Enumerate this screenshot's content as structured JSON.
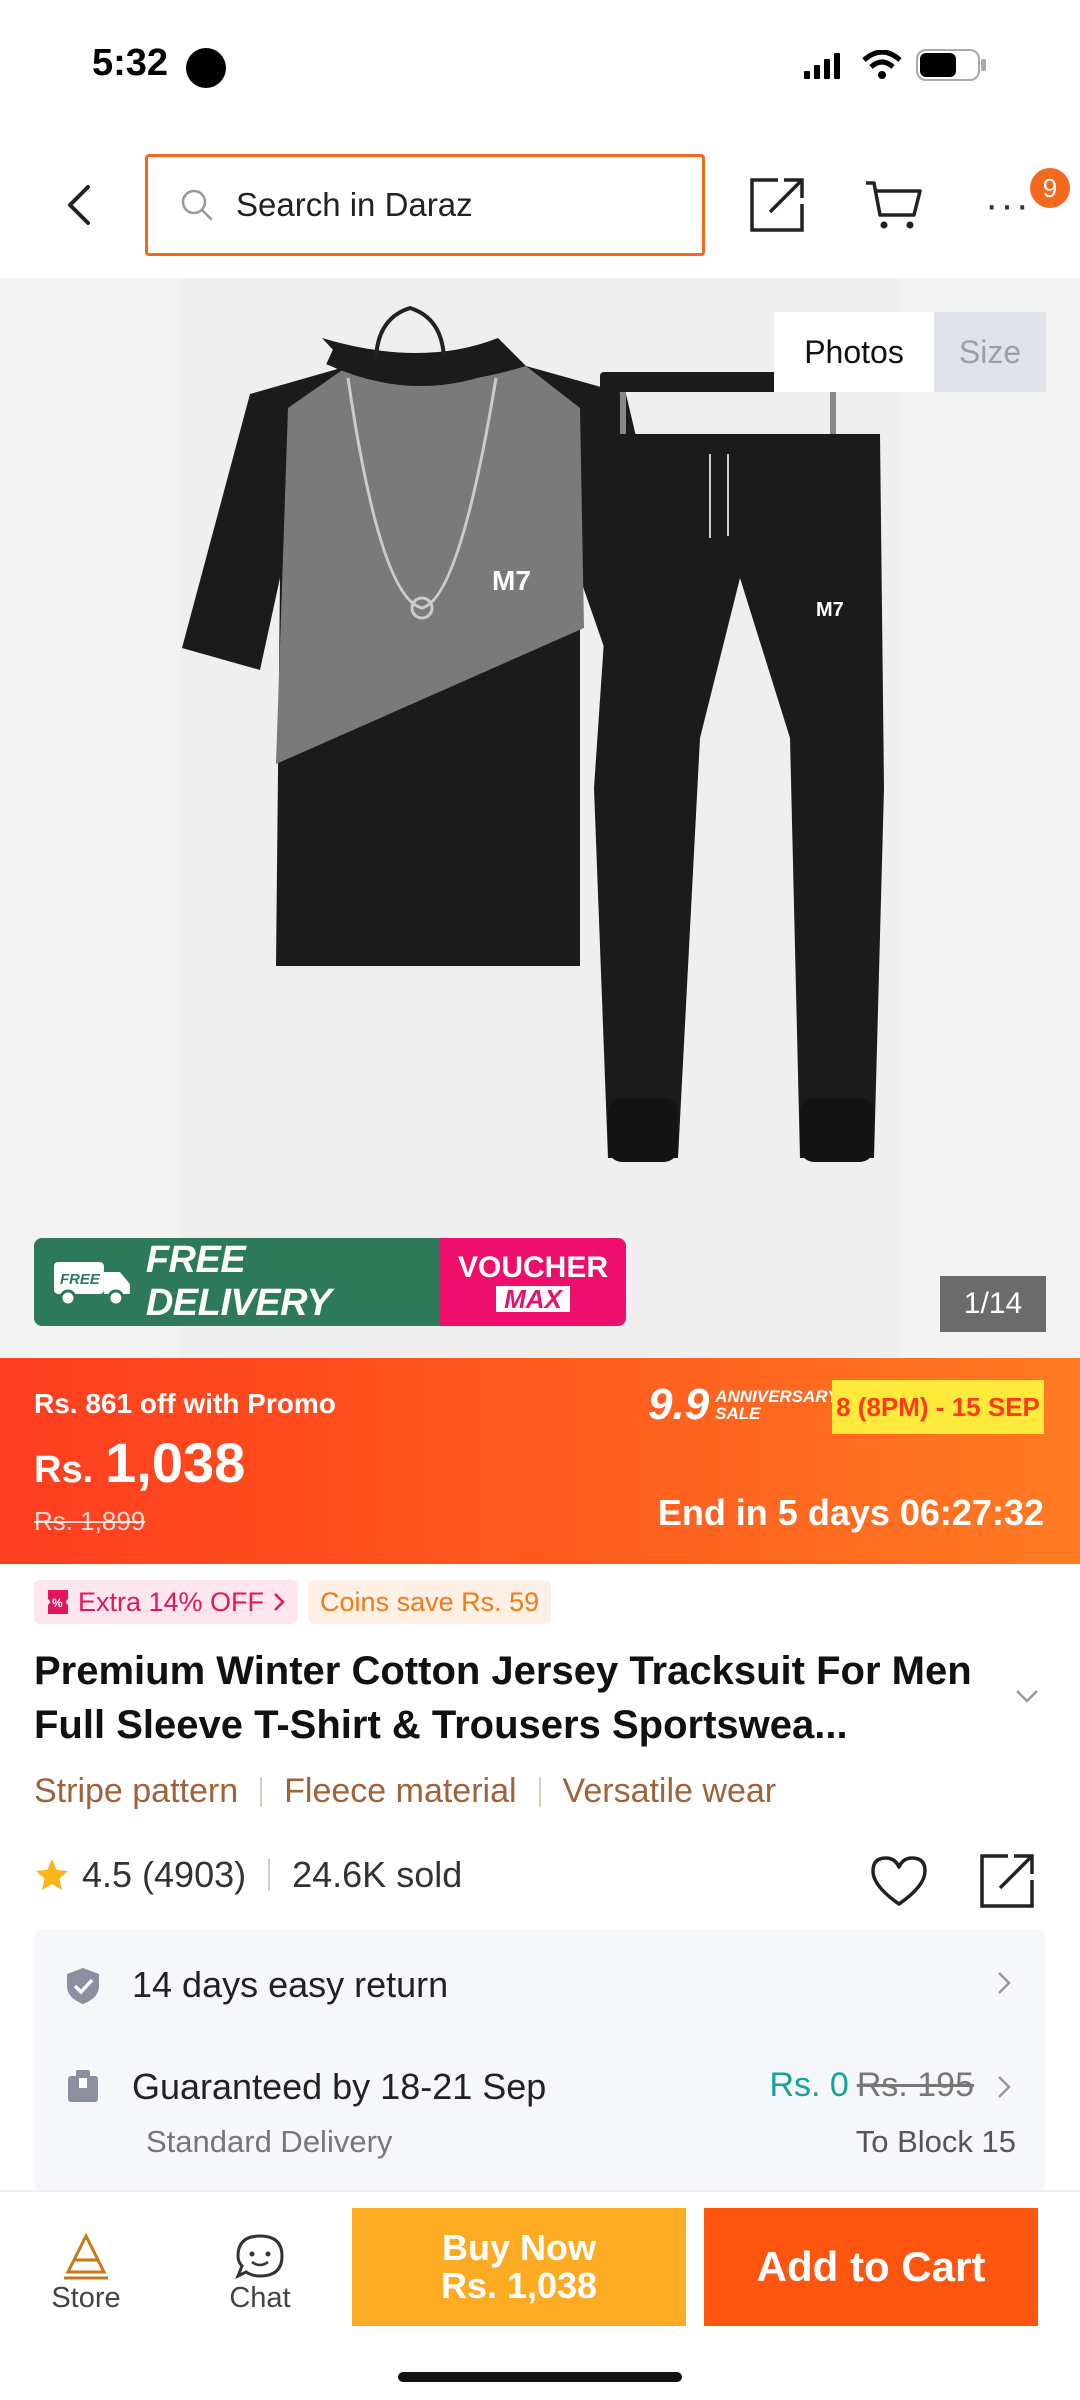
{
  "status_bar": {
    "time": "5:32"
  },
  "header": {
    "search_placeholder": "Search in Daraz",
    "cart_badge": "9",
    "more_label": "···"
  },
  "gallery": {
    "tabs": [
      {
        "label": "Photos"
      },
      {
        "label": "Size"
      }
    ],
    "counter": "1/14",
    "promo_free": "FREE DELIVERY",
    "promo_free_small": "FREE",
    "promo_voucher": "VOUCHER",
    "promo_max": "MAX",
    "logo_text": "M7"
  },
  "price": {
    "promo_off": "Rs. 861 off with Promo",
    "currency": "Rs.",
    "amount": "1,038",
    "old_price": "Rs. 1,899",
    "sale_logo_big": "9.9",
    "sale_logo_line1": "ANNIVERSARY",
    "sale_logo_line2": "SALE",
    "sale_dates": "8 (8PM) - 15 SEP",
    "countdown": "End in 5 days 06:27:32"
  },
  "product": {
    "chip_extra": "Extra 14% OFF",
    "chip_coins": "Coins save Rs. 59",
    "title": "Premium Winter Cotton Jersey Tracksuit For Men Full Sleeve T-Shirt & Trousers Sportswea...",
    "tags": [
      "Stripe pattern",
      "Fleece material",
      "Versatile wear"
    ],
    "rating": "4.5",
    "reviews": "(4903)",
    "sold": "24.6K sold"
  },
  "services": {
    "return_text": "14 days easy return",
    "delivery_text": "Guaranteed by 18-21 Sep",
    "delivery_sub": "Standard Delivery",
    "delivery_fee": "Rs. 0",
    "delivery_old_fee": "Rs. 195",
    "delivery_dest": "To Block 15"
  },
  "bottom": {
    "store_label": "Store",
    "chat_label": "Chat",
    "buy_now_label": "Buy Now",
    "buy_now_price": "Rs. 1,038",
    "add_to_cart_label": "Add to Cart"
  },
  "colors": {
    "accent": "#f36a1f",
    "buy_now": "#fdab23",
    "add_to_cart": "#fe5611",
    "free_delivery": "#2c7a5a",
    "voucher": "#ee0e6c",
    "tag_text": "#a0623a"
  }
}
